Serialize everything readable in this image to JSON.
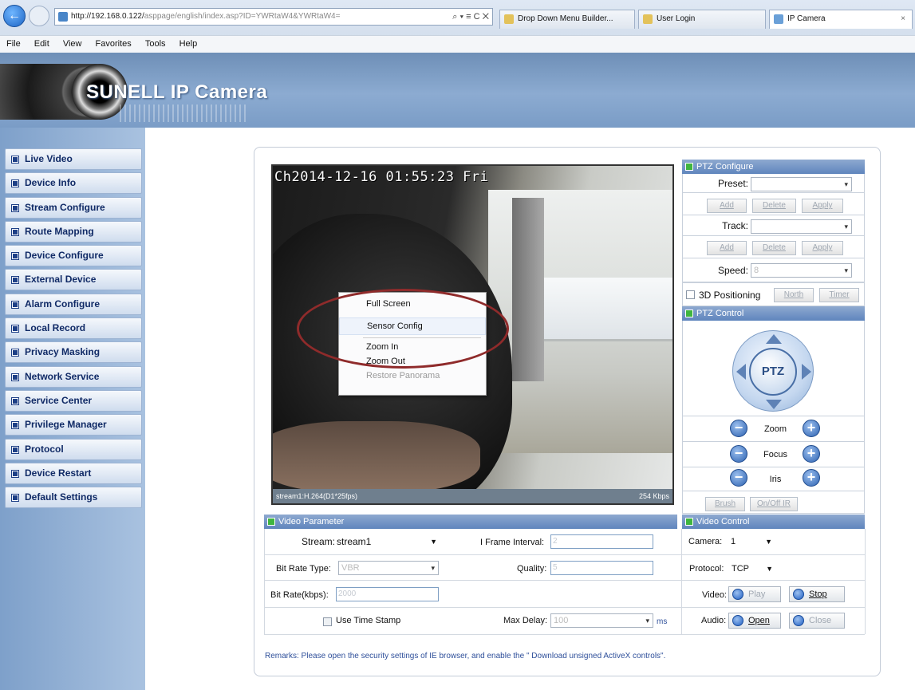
{
  "browser": {
    "address_host": "http://192.168.0.122/",
    "address_path": "asppage/english/index.asp?ID=YWRtaW4&YWRtaW4=",
    "address_tools": "⌕ ▾ ≡ C ✕",
    "tabs": [
      {
        "title": "Drop Down Menu Builder..."
      },
      {
        "title": "User Login"
      },
      {
        "title": "IP Camera"
      }
    ],
    "tab_close": "×",
    "back_glyph": "←",
    "menu": [
      "File",
      "Edit",
      "View",
      "Favorites",
      "Tools",
      "Help"
    ]
  },
  "banner": {
    "title": "SUNELL IP Camera"
  },
  "sidebar": {
    "items": [
      {
        "label": "Live Video"
      },
      {
        "label": "Device Info"
      },
      {
        "label": "Stream Configure"
      },
      {
        "label": "Route Mapping"
      },
      {
        "label": "Device Configure"
      },
      {
        "label": "External Device"
      },
      {
        "label": "Alarm Configure"
      },
      {
        "label": "Local Record"
      },
      {
        "label": "Privacy Masking"
      },
      {
        "label": "Network Service"
      },
      {
        "label": "Service Center"
      },
      {
        "label": "Privilege Manager"
      },
      {
        "label": "Protocol"
      },
      {
        "label": "Device Restart"
      },
      {
        "label": "Default Settings"
      }
    ]
  },
  "video": {
    "osd": "Ch2014-12-16 01:55:23 Fri",
    "status_left": "stream1:H.264(D1*25fps)",
    "status_right": "254 Kbps"
  },
  "context_menu": {
    "items": [
      "Full Screen",
      "Sensor Config",
      "Zoom In",
      "Zoom Out",
      "Restore Panorama"
    ]
  },
  "ptz": {
    "configure_title": "PTZ Configure",
    "preset_label": "Preset:",
    "track_label": "Track:",
    "speed_label": "Speed:",
    "speed_value": "8",
    "add": "Add",
    "delete": "Delete",
    "apply": "Apply",
    "positioning_label": "3D Positioning",
    "north": "North",
    "timer": "Timer",
    "control_title": "PTZ Control",
    "dial_label": "PTZ",
    "zoom": "Zoom",
    "focus": "Focus",
    "iris": "Iris",
    "minus": "−",
    "plus": "+",
    "brush": "Brush",
    "onoff": "On/Off IR"
  },
  "video_parameter": {
    "title": "Video Parameter",
    "stream_label": "Stream:",
    "stream_value": "stream1",
    "iframe_label": "I Frame Interval:",
    "iframe_value": "2",
    "bitrate_type_label": "Bit Rate Type:",
    "bitrate_type_value": "VBR",
    "quality_label": "Quality:",
    "quality_value": "5",
    "bitrate_label": "Bit Rate(kbps):",
    "bitrate_value": "2000",
    "timestamp_label": "Use Time Stamp",
    "maxdelay_label": "Max Delay:",
    "maxdelay_value": "100",
    "ms": "ms"
  },
  "video_control": {
    "title": "Video Control",
    "camera_label": "Camera:",
    "camera_value": "1",
    "protocol_label": "Protocol:",
    "protocol_value": "TCP",
    "video_label": "Video:",
    "play": "Play",
    "stop": "Stop",
    "audio_label": "Audio:",
    "open": "Open",
    "close": "Close"
  },
  "remarks": "Remarks: Please open the security settings of IE browser, and enable the \" Download unsigned ActiveX controls\"."
}
